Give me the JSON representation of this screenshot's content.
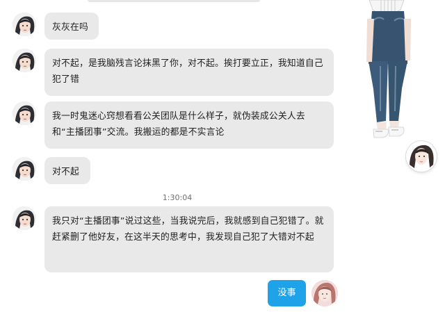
{
  "colors": {
    "incoming_bubble": "#e9e9ea",
    "outgoing_bubble": "#1fa3e8",
    "text": "#202020",
    "timestamp": "#6f6f6f"
  },
  "conversation": {
    "messages": [
      {
        "speaker": "other",
        "text": "灰灰在吗"
      },
      {
        "speaker": "other",
        "text": "对不起，是我脑残言论抹黑了你，对不起。挨打要立正，我知道自己犯了错"
      },
      {
        "speaker": "other",
        "text": "我一时鬼迷心窍想看看公关团队是什么样子，就伪装成公关人去和“主播团事”交流。我搬运的都是不实言论"
      },
      {
        "speaker": "other",
        "text": "对不起"
      },
      {
        "speaker": "other",
        "text": "我只对“主播团事”说过这些，当我说完后，我就感到自己犯错了。就赶紧删了他好友，在这半天的思考中，我发现自己犯了大错对不起"
      }
    ],
    "timestamp": "1:30:04",
    "self_message": "没事"
  },
  "icons": {
    "other_avatar": "anime-girl-avatar-icon",
    "self_avatar": "pink-hair-avatar-icon",
    "side_avatar": "girl-avatar-icon"
  }
}
